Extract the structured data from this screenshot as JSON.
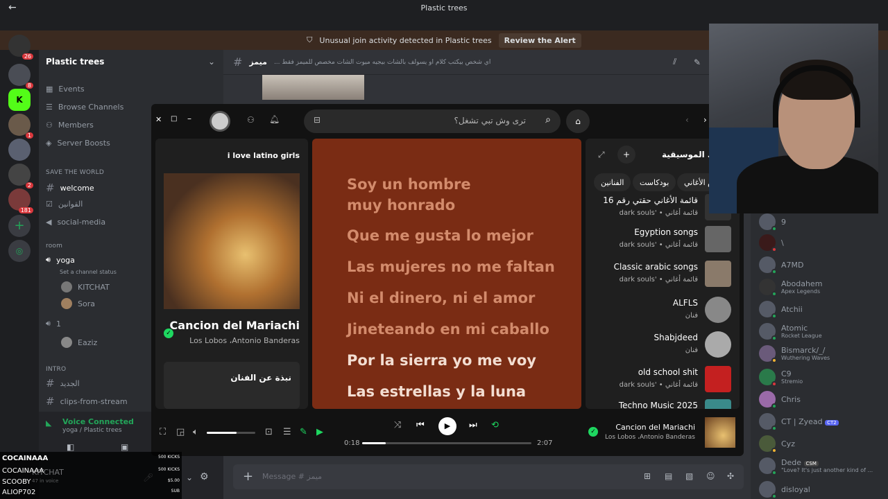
{
  "window": {
    "title": "Plastic trees"
  },
  "alert": {
    "text": "Unusual join activity detected in Plastic trees",
    "button": "Review the Alert"
  },
  "servers": {
    "badges": [
      "26",
      "8",
      "1",
      "2",
      "181"
    ]
  },
  "server": {
    "name": "Plastic trees",
    "menu": [
      "Events",
      "Browse Channels",
      "Members",
      "Server Boosts"
    ],
    "categories": {
      "save": "SAVE THE WORLD",
      "room": "room",
      "intro": "INTRO"
    },
    "channels": {
      "welcome": "welcome",
      "rules": "القوانين",
      "social": "social-media",
      "voice1": "yoga",
      "status": "Set a channel status",
      "voice2": "1",
      "newch": "الجديد",
      "clips": "clips-from-stream"
    },
    "voice_users": [
      "KITCHAT",
      "Sora",
      "Eaziz"
    ],
    "voice_connected": "Voice Connected",
    "voice_location": "yoga / Plastic trees"
  },
  "channel_header": {
    "name": "ميمز",
    "topic": "... اي شخص بيكتب كلام او يسولف بالشات بيجيه ميوت الشات مخصص للميمز فقط"
  },
  "message_placeholder": "Message # ميمز",
  "spotify": {
    "search_placeholder": "ترى وش تبي تشغل؟",
    "now_playing": {
      "playlist": "i love latino girls",
      "title": "Cancion del Mariachi",
      "artist": "Los Lobos ،Antonio Banderas",
      "about": "نبذة عن الفنان"
    },
    "lyrics": [
      "Soy un hombre",
      "muy honrado",
      "Que me gusta lo mejor",
      "Las mujeres no me faltan",
      "Ni el dinero, ni el amor",
      "Jineteando en mi caballo",
      "Por la sierra yo me voy",
      "Las estrellas y la luna"
    ],
    "library": {
      "title": "ك الموسيقية",
      "chips": [
        "الفنانين",
        "بودكاست",
        "م الأغاني"
      ],
      "items": [
        {
          "name": "قائمة الأغاني حقتي رقم 16",
          "sub": "dark souls' • قائمة أغاني"
        },
        {
          "name": "Egyption songs",
          "sub": "dark souls' • قائمة أغاني"
        },
        {
          "name": "Classic arabic songs",
          "sub": "dark souls' • قائمة أغاني"
        },
        {
          "name": "ALFLS",
          "sub": "فنان"
        },
        {
          "name": "Shabjdeed",
          "sub": "فنان"
        },
        {
          "name": "old school shit",
          "sub": "dark souls' • قائمة أغاني"
        },
        {
          "name": "Techno Music 2025",
          "sub": ""
        }
      ]
    },
    "player": {
      "elapsed": "0:18",
      "duration": "2:07",
      "progress": 0.14,
      "volume": 0.62,
      "title": "Cancion del Mariachi",
      "artist": "Los Lobos ،Antonio Banderas"
    }
  },
  "members": [
    {
      "name": "9",
      "status": ""
    },
    {
      "name": "\\",
      "status": ""
    },
    {
      "name": "A7MD",
      "status": ""
    },
    {
      "name": "Abodahem",
      "status": "Apex Legends"
    },
    {
      "name": "Atchii",
      "status": ""
    },
    {
      "name": "Atomic",
      "status": "Rocket League"
    },
    {
      "name": "Bismarck/_/",
      "status": "Wuthering Waves"
    },
    {
      "name": "C9",
      "status": "Stremio"
    },
    {
      "name": "Chris",
      "status": ""
    },
    {
      "name": "CT | Zyead",
      "status": "",
      "tag": "CT2"
    },
    {
      "name": "Cyz",
      "status": ""
    },
    {
      "name": "Dede",
      "status": "\"Love? It's just another kind of ...",
      "tag": "CSM"
    },
    {
      "name": "disloyal",
      "status": ""
    }
  ],
  "chat_overlay": [
    {
      "name": "COCAINAAA",
      "tag": "500 KICKS"
    },
    {
      "name": "COCAINAAA",
      "tag": "500 KICKS"
    },
    {
      "name": "SCOOBY",
      "tag": "$5.00"
    },
    {
      "name": "ALIOP702",
      "tag": "SUB"
    }
  ],
  "under_overlay": {
    "name": "KITCHAT",
    "sub": "47 in voice"
  }
}
